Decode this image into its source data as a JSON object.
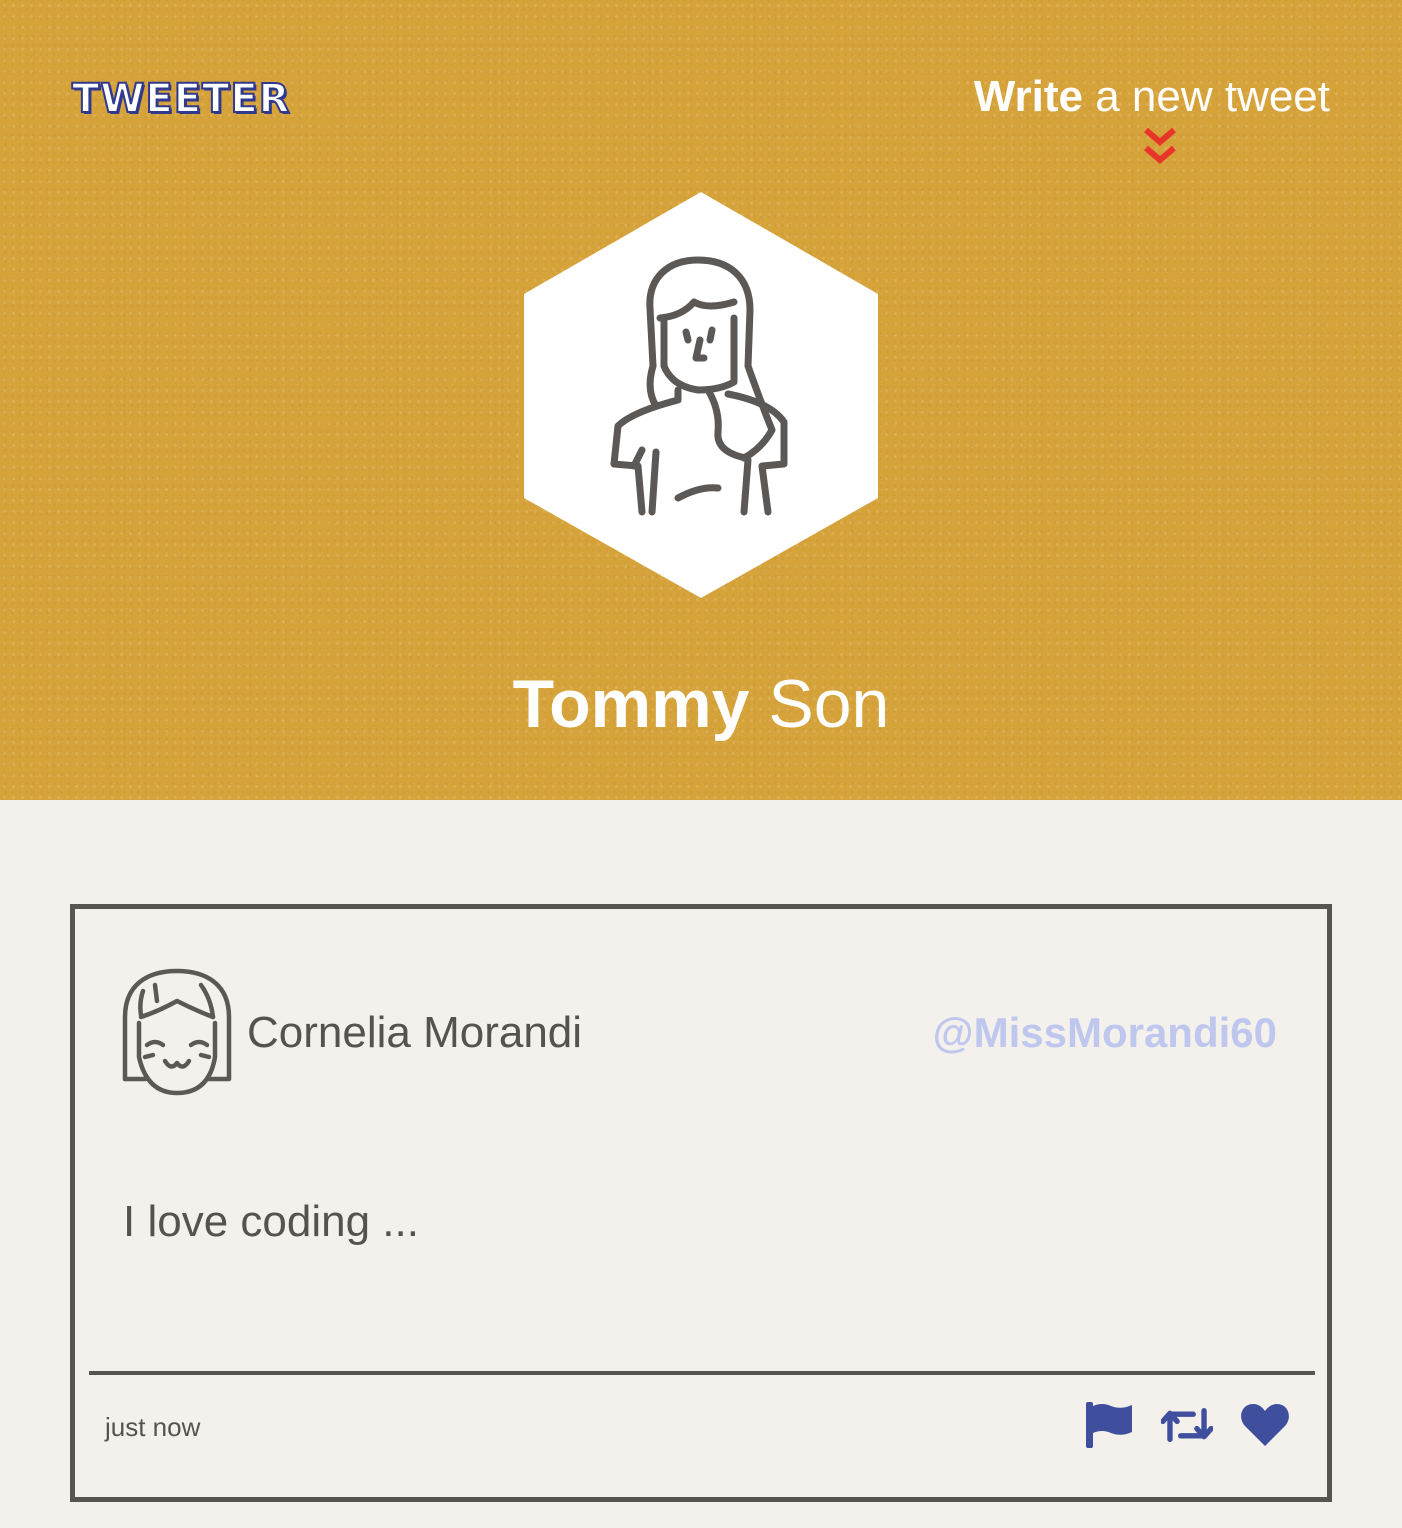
{
  "brand": {
    "logo_text": "TWEETER"
  },
  "compose": {
    "bold_label": "Write",
    "label": "a new tweet",
    "toggle_icon": "double-chevron-down-icon",
    "toggle_color": "#e8352a"
  },
  "profile": {
    "avatar_icon": "woman-avatar-icon",
    "first_name": "Tommy",
    "last_name": "Son"
  },
  "tweet": {
    "avatar_icon": "girl-face-avatar-icon",
    "author_name": "Cornelia Morandi",
    "handle": "@MissMorandi60",
    "body": "I love coding ...",
    "timestamp": "just now",
    "actions": [
      {
        "icon": "flag-icon",
        "action": "flag"
      },
      {
        "icon": "retweet-icon",
        "action": "retweet"
      },
      {
        "icon": "heart-icon",
        "action": "like"
      }
    ]
  },
  "colors": {
    "header_bg": "#d6a23a",
    "page_bg": "#f4f1ed",
    "text_dark": "#555250",
    "handle": "#bfc7ee",
    "action_icons": "#3f4f9e",
    "brand_outline": "#2f3a8f"
  }
}
